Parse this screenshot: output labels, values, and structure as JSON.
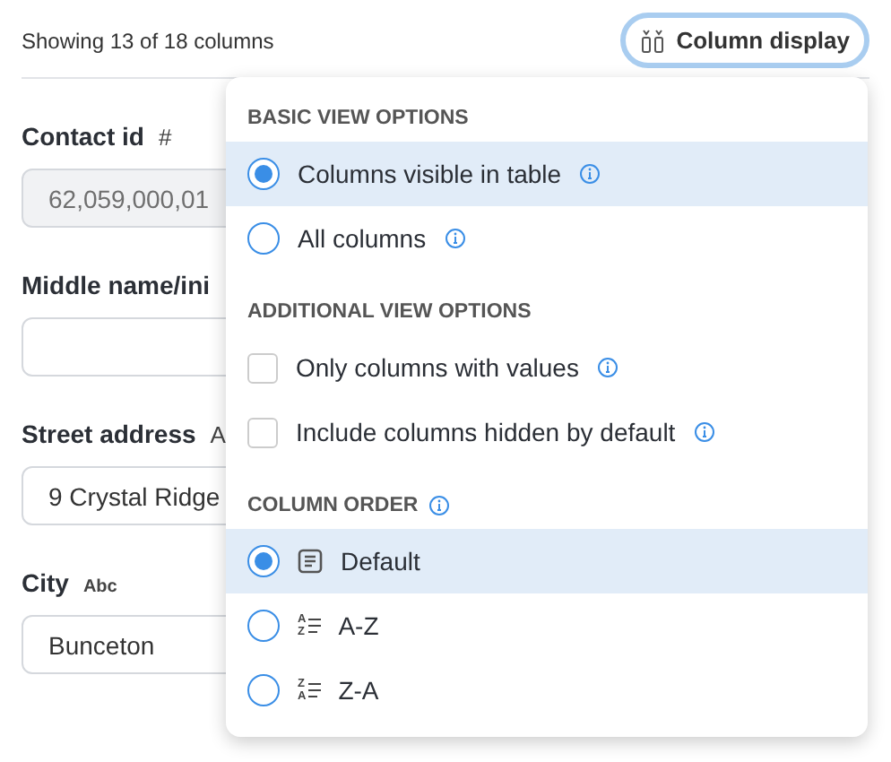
{
  "header": {
    "summary": "Showing 13 of 18 columns",
    "column_display_button": "Column display"
  },
  "form": {
    "fields": [
      {
        "label": "Contact id",
        "type_mark": "#",
        "value": "62,059,000,01",
        "disabled": true
      },
      {
        "label": "Middle name/ini",
        "disabled": false
      },
      {
        "label": "Street address",
        "type_mark": "A",
        "value": "9 Crystal Ridge",
        "disabled": false
      },
      {
        "label": "City",
        "type_mark": "Abc",
        "value": "Bunceton",
        "disabled": false
      }
    ]
  },
  "menu": {
    "sections": [
      {
        "heading": "BASIC VIEW OPTIONS",
        "info": false,
        "options": [
          {
            "kind": "radio",
            "label": "Columns visible in table",
            "selected": true,
            "info": true
          },
          {
            "kind": "radio",
            "label": "All columns",
            "selected": false,
            "info": true
          }
        ]
      },
      {
        "heading": "ADDITIONAL VIEW OPTIONS",
        "info": false,
        "options": [
          {
            "kind": "checkbox",
            "label": "Only columns with values",
            "checked": false,
            "info": true
          },
          {
            "kind": "checkbox",
            "label": "Include columns hidden by default",
            "checked": false,
            "info": true
          }
        ]
      },
      {
        "heading": "COLUMN ORDER",
        "info": true,
        "options": [
          {
            "kind": "order",
            "label": "Default",
            "selected": true,
            "info": false
          },
          {
            "kind": "order",
            "label": "A-Z",
            "selected": false,
            "info": false,
            "icon_text": [
              "A",
              "Z"
            ]
          },
          {
            "kind": "order",
            "label": "Z-A",
            "selected": false,
            "info": false,
            "icon_text": [
              "Z",
              "A"
            ]
          }
        ]
      }
    ]
  }
}
